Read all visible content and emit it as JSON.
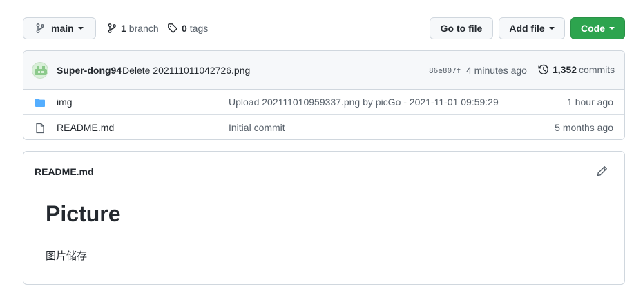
{
  "toolbar": {
    "branch_label": "main",
    "branch_count": "1",
    "branch_word": "branch",
    "tag_count": "0",
    "tag_word": "tags",
    "goto_file": "Go to file",
    "add_file": "Add file",
    "code": "Code"
  },
  "commit": {
    "author": "Super-dong94",
    "message": "Delete 202111011042726.png",
    "sha": "86e807f",
    "time": "4 minutes ago",
    "count": "1,352",
    "count_word": "commits"
  },
  "files": [
    {
      "name": "img",
      "type": "folder",
      "message": "Upload 202111010959337.png by picGo - 2021-11-01 09:59:29",
      "age": "1 hour ago"
    },
    {
      "name": "README.md",
      "type": "file",
      "message": "Initial commit",
      "age": "5 months ago"
    }
  ],
  "readme": {
    "title": "README.md",
    "heading": "Picture",
    "paragraph": "图片储存"
  },
  "colors": {
    "code_button": "#2da44e",
    "folder_icon": "#54aeff",
    "border": "#d0d7de"
  },
  "icons": [
    "git-branch-icon",
    "tag-icon",
    "history-icon",
    "folder-icon",
    "file-icon",
    "pencil-icon"
  ]
}
